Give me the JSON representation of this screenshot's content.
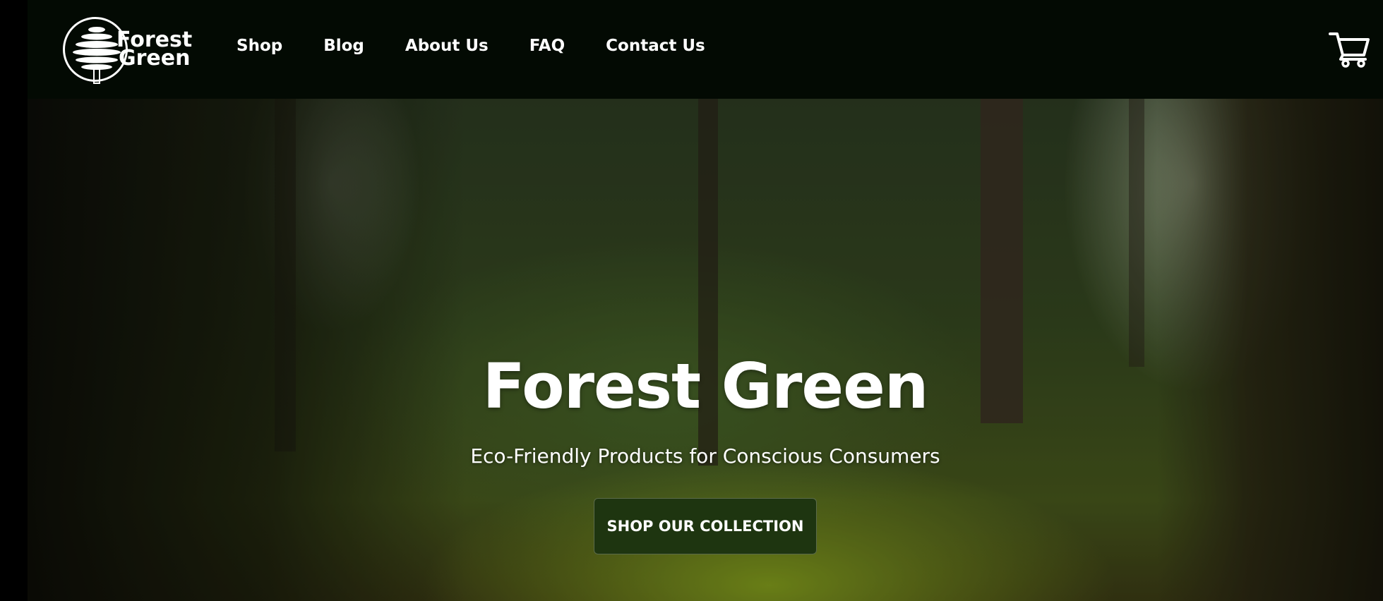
{
  "brand": {
    "name_line1": "Forest",
    "name_line2": "Green"
  },
  "nav": {
    "items": [
      {
        "label": "Shop"
      },
      {
        "label": "Blog"
      },
      {
        "label": "About Us"
      },
      {
        "label": "FAQ"
      },
      {
        "label": "Contact Us"
      }
    ],
    "cart_icon": "shopping-cart-icon"
  },
  "hero": {
    "title": "Forest Green",
    "subtitle": "Eco-Friendly Products for Conscious Consumers",
    "cta_label": "SHOP OUR COLLECTION",
    "background": "forest-photo"
  },
  "colors": {
    "navbar_bg": "#030a03",
    "cta_bg": "#1e3510",
    "text": "#ffffff"
  }
}
